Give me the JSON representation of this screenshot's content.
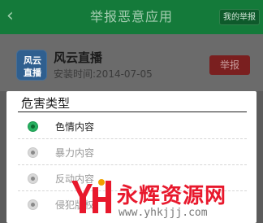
{
  "header": {
    "title": "举报恶意应用",
    "back_icon": "back-chevron-icon",
    "my_reports_label": "我的举报"
  },
  "app": {
    "name": "风云直播",
    "install_time": "安装时间:2014-07-05",
    "icon_text": [
      "风云",
      "直播"
    ],
    "report_label": "举报"
  },
  "dialog": {
    "title": "危害类型",
    "options": [
      {
        "label": "色情内容",
        "selected": true
      },
      {
        "label": "暴力内容",
        "selected": false
      },
      {
        "label": "反动内容",
        "selected": false
      },
      {
        "label": "侵犯版权",
        "selected": false
      }
    ]
  },
  "watermark": {
    "text": "永辉资源网",
    "url": "www.yhkjjj.com"
  },
  "colors": {
    "topbar": "#147a3a",
    "accent_green": "#27b060",
    "report_red": "#7a1f1f",
    "watermark_red": "#e8182c"
  }
}
